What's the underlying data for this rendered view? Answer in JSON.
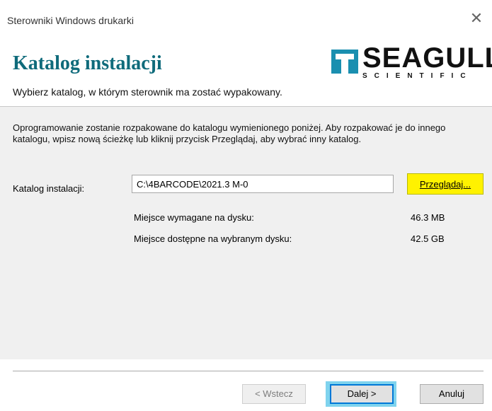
{
  "window": {
    "title": "Sterowniki Windows drukarki",
    "close_glyph": "✕"
  },
  "header": {
    "heading": "Katalog instalacji",
    "subtitle": "Wybierz katalog, w którym sterownik ma zostać wypakowany.",
    "logo_text": "SEAGULL",
    "logo_subtext": "SCIENTIFIC"
  },
  "content": {
    "description": "Oprogramowanie zostanie rozpakowane do katalogu wymienionego poniżej. Aby rozpakować je do innego katalogu, wpisz nową ścieżkę lub kliknij przycisk Przeglądaj, aby wybrać inny katalog.",
    "install_dir_label": "Katalog instalacji:",
    "install_dir_value": "C:\\4BARCODE\\2021.3 M-0",
    "browse_label": "Przeglądaj...",
    "space_required_label": "Miejsce wymagane na dysku:",
    "space_required_value": "46.3 MB",
    "space_available_label": "Miejsce dostępne na wybranym dysku:",
    "space_available_value": "42.5 GB"
  },
  "footer": {
    "back_label": "< Wstecz",
    "next_label": "Dalej >",
    "cancel_label": "Anuluj"
  },
  "colors": {
    "heading": "#0f6b7b",
    "browse_highlight": "#fff200",
    "next_highlight": "#7fd3ee",
    "focus_border": "#0078d7"
  }
}
